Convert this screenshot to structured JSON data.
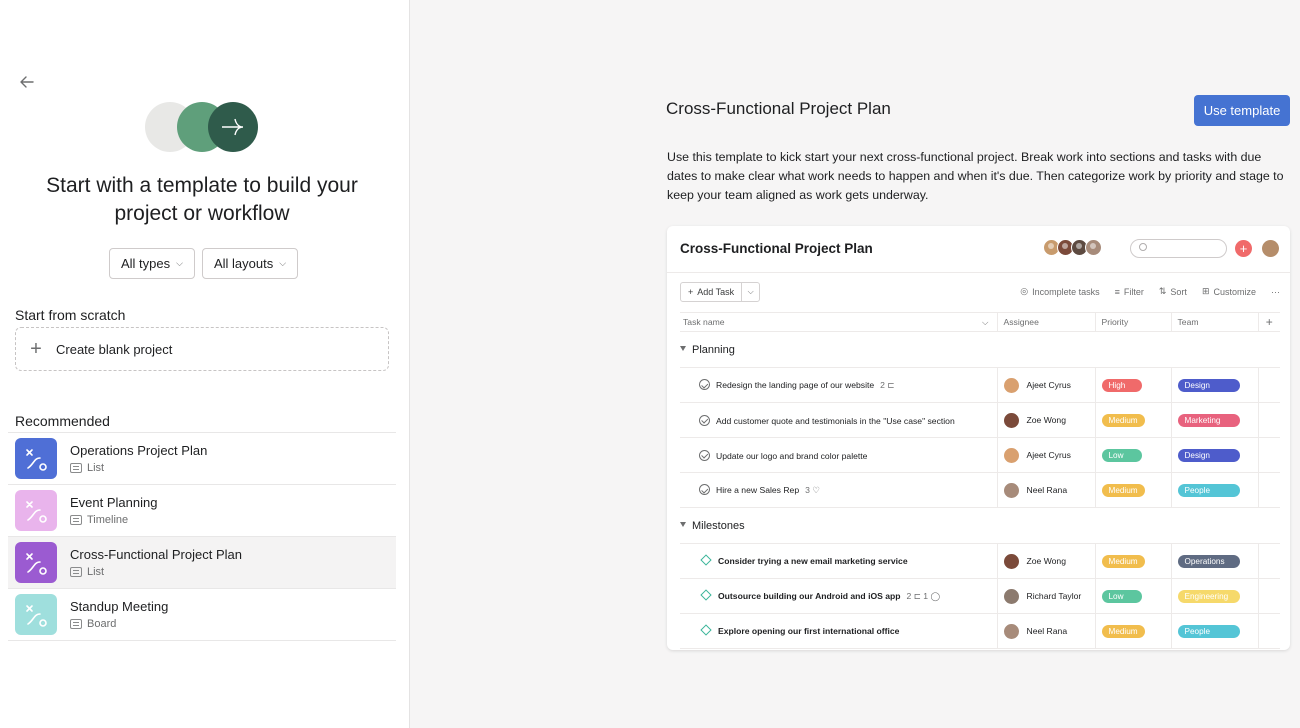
{
  "left": {
    "headline_line1": "Start with a template to build your",
    "headline_line2": "project or workflow",
    "filters": {
      "types": "All types",
      "layouts": "All layouts"
    },
    "scratch_title": "Start from scratch",
    "blank_project": "Create blank project",
    "recommended_title": "Recommended",
    "recommended": [
      {
        "name": "Operations Project Plan",
        "layout": "List",
        "icon_color": "#4f6fd6"
      },
      {
        "name": "Event Planning",
        "layout": "Timeline",
        "icon_color": "#e9b4ec"
      },
      {
        "name": "Cross-Functional Project Plan",
        "layout": "List",
        "icon_color": "#9b5bd1"
      },
      {
        "name": "Standup Meeting",
        "layout": "Board",
        "icon_color": "#9fdfdd"
      }
    ]
  },
  "right": {
    "title": "Cross-Functional Project Plan",
    "use_template": "Use template",
    "description": "Use this template to kick start your next cross-functional project. Break work into sections and tasks with due dates to make clear what work needs to happen and when it's due. Then categorize work by priority and stage to keep your team aligned as work gets underway."
  },
  "preview": {
    "title": "Cross-Functional Project Plan",
    "add_task": "Add Task",
    "toolbar": {
      "incomplete": "Incomplete tasks",
      "filter": "Filter",
      "sort": "Sort",
      "customize": "Customize",
      "more": "···"
    },
    "columns": {
      "task": "Task name",
      "assignee": "Assignee",
      "priority": "Priority",
      "team": "Team"
    },
    "sections": [
      {
        "name": "Planning",
        "tasks": [
          {
            "name": "Redesign the landing page of our website",
            "meta": "2 ⊏",
            "assignee": "Ajeet Cyrus",
            "priority": "High",
            "team": "Design"
          },
          {
            "name": "Add customer quote and testimonials in the \"Use case\" section",
            "meta": "",
            "assignee": "Zoe Wong",
            "priority": "Medium",
            "team": "Marketing"
          },
          {
            "name": "Update our logo and brand color palette",
            "meta": "",
            "assignee": "Ajeet Cyrus",
            "priority": "Low",
            "team": "Design"
          },
          {
            "name": "Hire a new Sales Rep",
            "meta": "3 ♡",
            "assignee": "Neel Rana",
            "priority": "Medium",
            "team": "People"
          }
        ]
      },
      {
        "name": "Milestones",
        "tasks": [
          {
            "name": "Consider trying a new email marketing service",
            "meta": "",
            "assignee": "Zoe Wong",
            "priority": "Medium",
            "team": "Operations"
          },
          {
            "name": "Outsource building our Android and iOS app",
            "meta": "2 ⊏   1 ◯",
            "assignee": "Richard Taylor",
            "priority": "Low",
            "team": "Engineering"
          },
          {
            "name": "Explore opening our first international office",
            "meta": "",
            "assignee": "Neel Rana",
            "priority": "Medium",
            "team": "People"
          }
        ]
      }
    ],
    "colors": {
      "High": "#f06a6a",
      "Medium": "#f1bd4d",
      "Low": "#5cc69f",
      "Design": "#4e5ccb",
      "Marketing": "#e8627e",
      "People": "#54c5d6",
      "Operations": "#5f6b82",
      "Engineering": "#f6d96b"
    },
    "person_colors": {
      "Ajeet Cyrus": "#d9a06f",
      "Zoe Wong": "#7b4a3a",
      "Neel Rana": "#a78b7a",
      "Richard Taylor": "#8c7a6e"
    }
  }
}
